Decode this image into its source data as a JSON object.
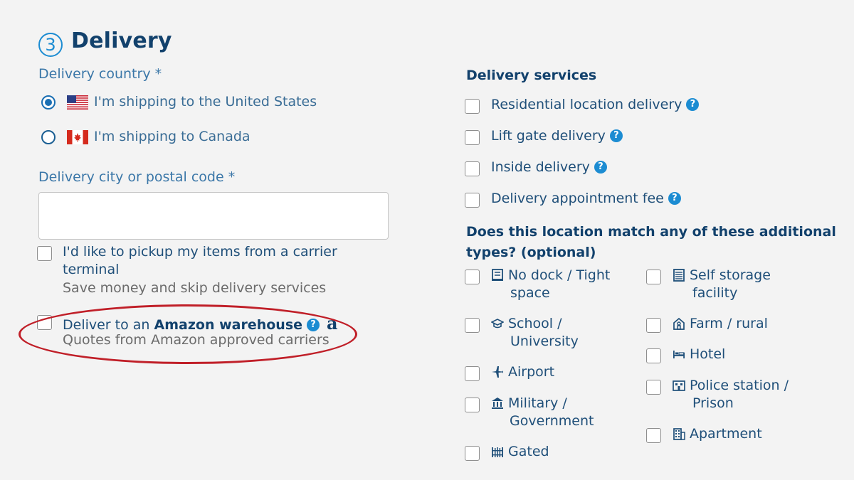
{
  "section": {
    "step_number": "3",
    "title": "Delivery"
  },
  "country": {
    "label": "Delivery country *",
    "options": [
      {
        "label": "I'm shipping to the United States",
        "selected": true,
        "flag": "us-flag-icon"
      },
      {
        "label": "I'm shipping to Canada",
        "selected": false,
        "flag": "ca-flag-icon"
      }
    ]
  },
  "city": {
    "label": "Delivery city or postal code *",
    "value": ""
  },
  "pickup": {
    "line1": "I'd like to pickup my items from a carrier",
    "line2": "terminal",
    "sub": "Save money and skip delivery services"
  },
  "amazon": {
    "prefix": "Deliver to an ",
    "bold": "Amazon warehouse",
    "logo": "a",
    "sub": "Quotes from Amazon approved carriers",
    "help": "?"
  },
  "services": {
    "heading": "Delivery services",
    "items": [
      {
        "label": "Residential location delivery",
        "help": "?"
      },
      {
        "label": "Lift gate delivery",
        "help": "?"
      },
      {
        "label": "Inside delivery",
        "help": "?"
      },
      {
        "label": "Delivery appointment fee",
        "help": "?"
      }
    ]
  },
  "types": {
    "heading_line1": "Does this location match any of these additional",
    "heading_line2": "types? (optional)",
    "left": [
      {
        "line1": "No dock / Tight",
        "line2": "space",
        "icon": "truck-icon"
      },
      {
        "line1": "School /",
        "line2": "University",
        "icon": "graduation-cap-icon"
      },
      {
        "line1": "Airport",
        "line2": "",
        "icon": "airplane-icon"
      },
      {
        "line1": "Military /",
        "line2": "Government",
        "icon": "government-building-icon"
      },
      {
        "line1": "Gated",
        "line2": "",
        "icon": "gate-icon"
      }
    ],
    "right": [
      {
        "line1": "Self storage",
        "line2": "facility",
        "icon": "storage-icon"
      },
      {
        "line1": "Farm / rural",
        "line2": "",
        "icon": "farm-icon"
      },
      {
        "line1": "Hotel",
        "line2": "",
        "icon": "bed-icon"
      },
      {
        "line1": "Police station /",
        "line2": "Prison",
        "icon": "police-icon"
      },
      {
        "line1": "Apartment",
        "line2": "",
        "icon": "apartment-icon"
      }
    ]
  },
  "colors": {
    "accent": "#1c8cd2",
    "heading": "#12416c",
    "highlight": "#c01f28",
    "background": "#f3f3f3"
  }
}
